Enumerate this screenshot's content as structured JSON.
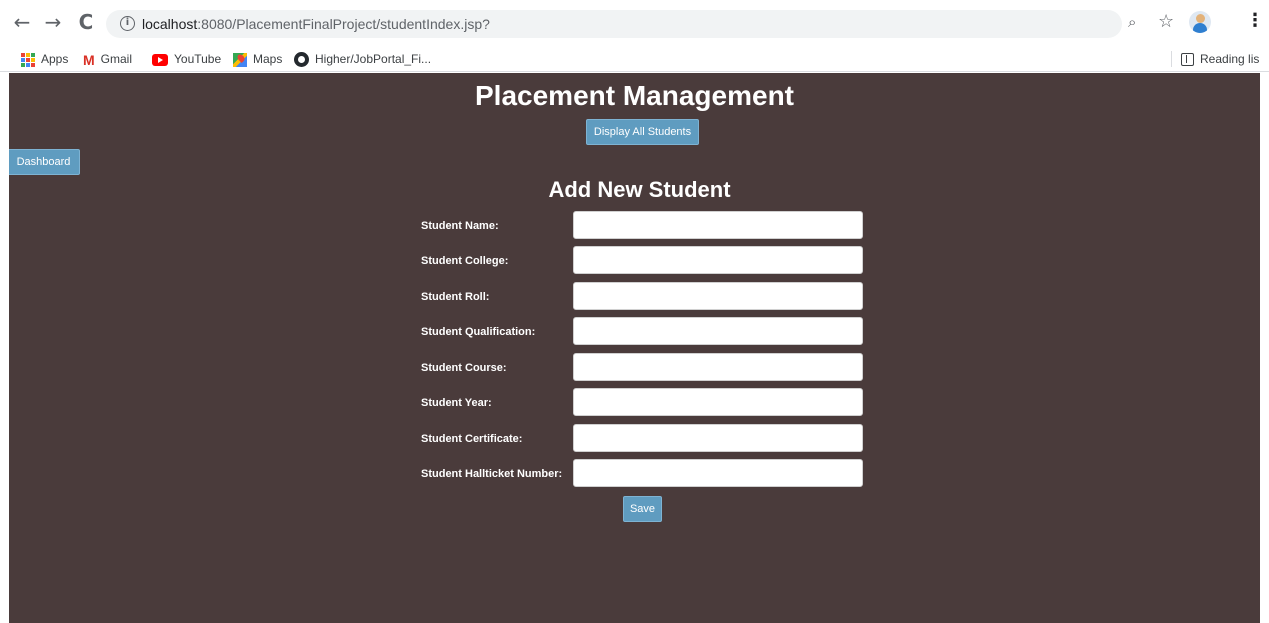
{
  "browser": {
    "back_glyph": "←",
    "forward_glyph": "→",
    "reload_glyph": "C",
    "info_glyph": "i",
    "url_host": "localhost",
    "url_rest": ":8080/PlacementFinalProject/studentIndex.jsp?",
    "zoom_glyph": "⌕",
    "star_glyph": "☆",
    "menu_glyph": "⋮"
  },
  "bookmarks": {
    "items": [
      {
        "label": "Apps",
        "icon": "apps-grid-icon"
      },
      {
        "label": "Gmail",
        "icon": "gmail-icon"
      },
      {
        "label": "YouTube",
        "icon": "youtube-icon"
      },
      {
        "label": "Maps",
        "icon": "maps-icon"
      },
      {
        "label": "Higher/JobPortal_Fi...",
        "icon": "github-icon"
      }
    ],
    "reading_list": "Reading lis",
    "gmail_glyph": "M"
  },
  "page": {
    "title": "Placement Management",
    "display_all_button": "Display All Students",
    "dashboard_button": "Dashboard",
    "form_title": "Add New Student",
    "fields": [
      {
        "label": "Student Name:",
        "value": ""
      },
      {
        "label": "Student College:",
        "value": ""
      },
      {
        "label": "Student Roll:",
        "value": ""
      },
      {
        "label": "Student Qualification:",
        "value": ""
      },
      {
        "label": "Student Course:",
        "value": ""
      },
      {
        "label": "Student Year:",
        "value": ""
      },
      {
        "label": "Student Certificate:",
        "value": ""
      },
      {
        "label": "Student Hallticket Number:",
        "value": ""
      }
    ],
    "save_button": "Save"
  },
  "colors": {
    "page_background": "#4a3b3b",
    "button": "#5f9cc0",
    "text": "#ffffff"
  }
}
